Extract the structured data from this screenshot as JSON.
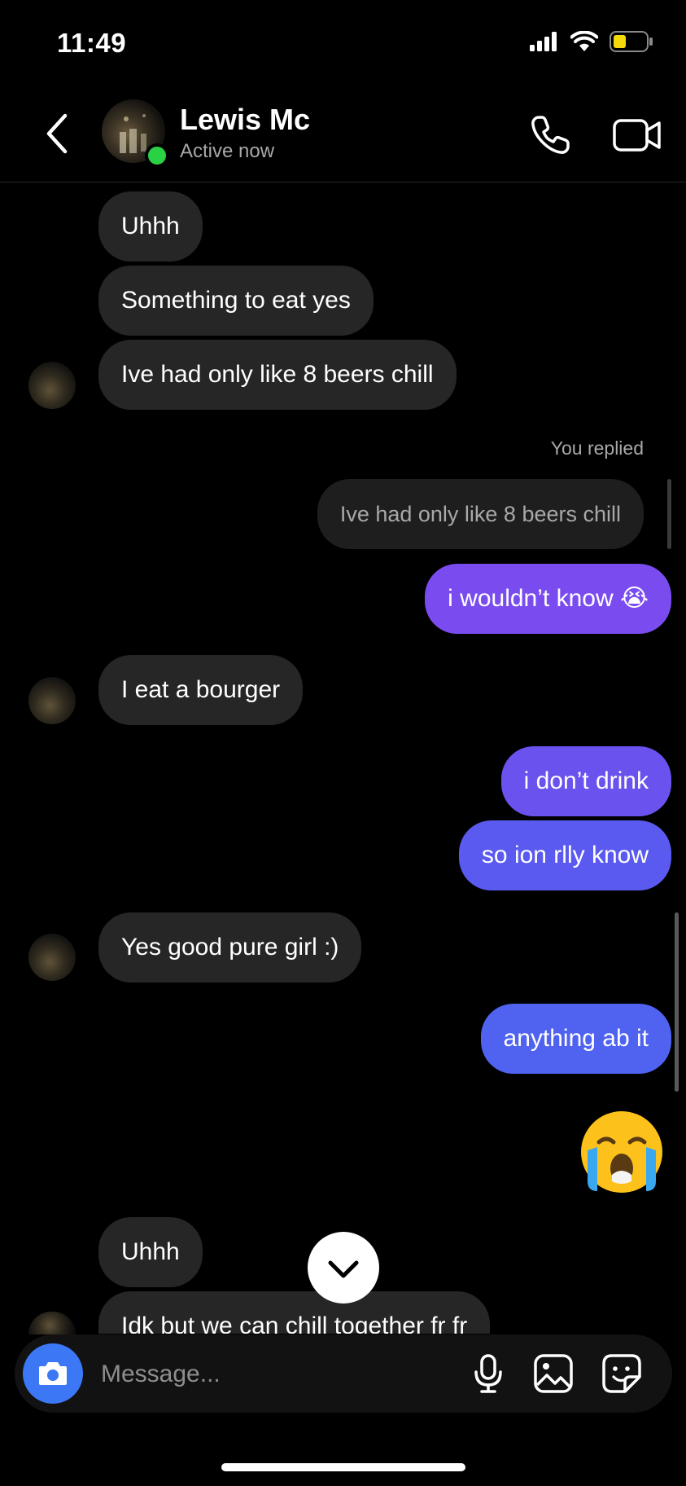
{
  "status_bar": {
    "time": "11:49"
  },
  "header": {
    "contact_name": "Lewis Mc",
    "status": "Active now"
  },
  "messages": {
    "m1": "Uhhh",
    "m2": "Something to eat yes",
    "m3": "Ive had only like 8 beers chill",
    "replied_label": "You replied",
    "quoted": "Ive had only like 8 beers chill",
    "m4": "i wouldn’t know 😭",
    "m5": "I eat a bourger",
    "m6": "i don’t drink",
    "m7": "so ion rlly know",
    "m8": "Yes good pure girl :)",
    "m9": "anything ab it",
    "m10": "Uhhh",
    "m11": "Idk but we can chill together fr fr"
  },
  "composer": {
    "placeholder": "Message..."
  },
  "colors": {
    "bubble_in": "#262626",
    "out_1": "#7a4cf0",
    "out_2": "#6a52ee",
    "out_3": "#5a5af0",
    "out_4": "#4f62f0",
    "active": "#2bd145",
    "camera": "#3c78f5"
  }
}
